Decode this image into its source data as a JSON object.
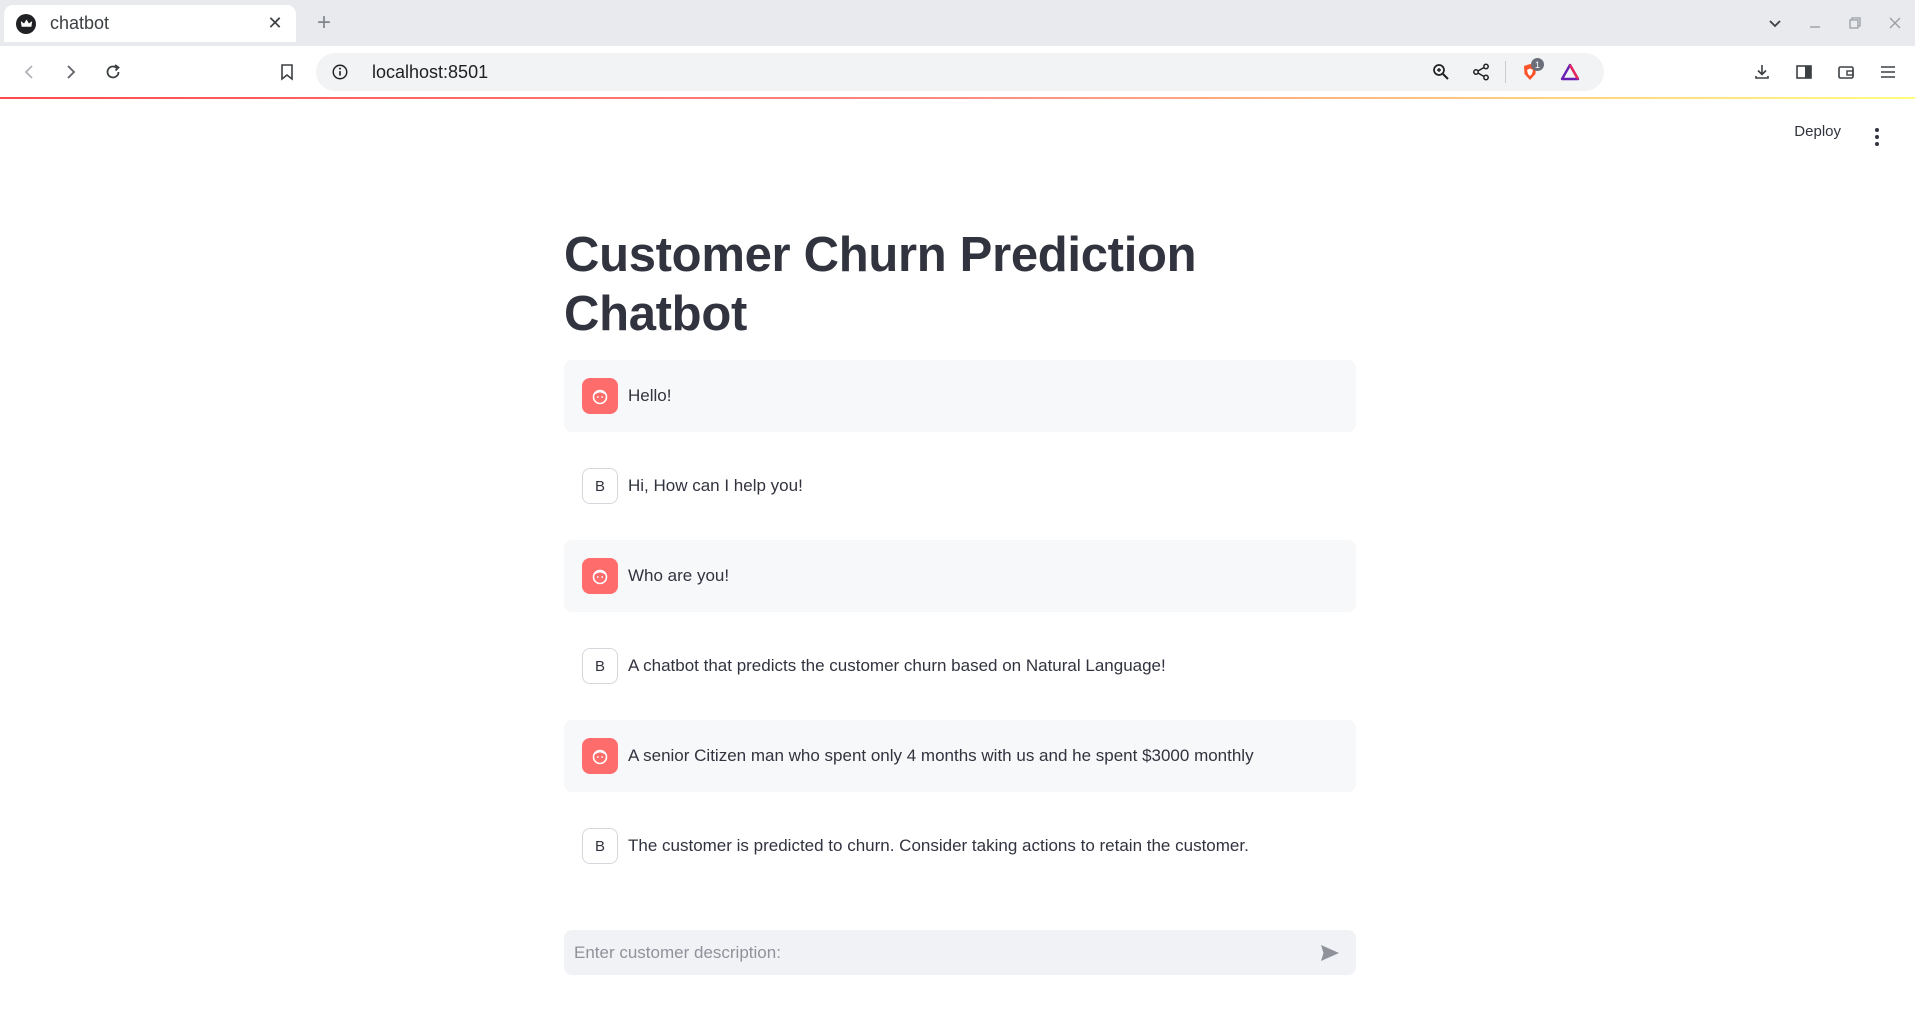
{
  "browser": {
    "tab_title": "chatbot",
    "url": "localhost:8501",
    "shield_count": "1"
  },
  "app": {
    "deploy_label": "Deploy",
    "title": "Customer Churn Prediction Chatbot",
    "input_placeholder": "Enter customer description:",
    "bot_avatar_letter": "B"
  },
  "messages": [
    {
      "role": "user",
      "text": "Hello!"
    },
    {
      "role": "bot",
      "text": "Hi, How can I help you!"
    },
    {
      "role": "user",
      "text": "Who are you!"
    },
    {
      "role": "bot",
      "text": "A chatbot that predicts the customer churn based on Natural Language!"
    },
    {
      "role": "user",
      "text": "A senior Citizen man who spent only 4 months with us and he spent $3000 monthly"
    },
    {
      "role": "bot",
      "text": "The customer is predicted to churn. Consider taking actions to retain the customer."
    }
  ],
  "colors": {
    "user_avatar": "#ff6c6c",
    "user_bubble": "#f7f8fa",
    "input_bg": "#f0f2f6",
    "text": "#31333f"
  }
}
